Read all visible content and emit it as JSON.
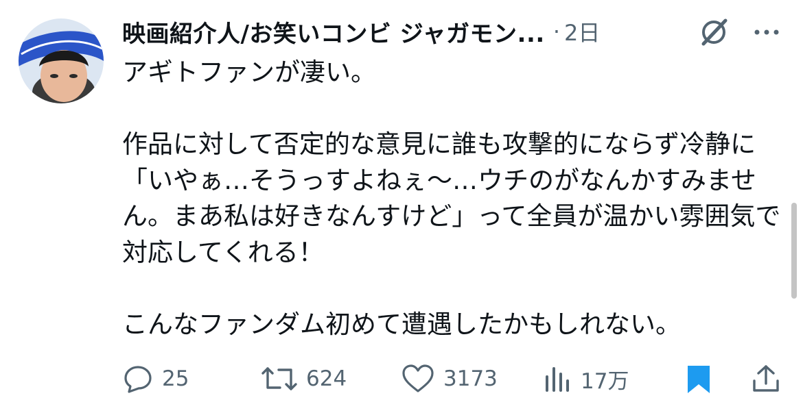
{
  "author": {
    "display_name": "映画紹介人/お笑いコンビ ジャガモン...",
    "time_sep": "·",
    "time": "2日"
  },
  "tweet": {
    "text": "アギトファンが凄い。\n\n作品に対して否定的な意見に誰も攻撃的にならず冷静に「いやぁ…そうっすよねぇ〜…ウチのがなんかすみません。まあ私は好きなんすけど」って全員が温かい雰囲気で対応してくれる！\n\nこんなファンダム初めて遭遇したかもしれない。"
  },
  "actions": {
    "reply": {
      "icon": "reply-icon",
      "count": "25"
    },
    "retweet": {
      "icon": "retweet-icon",
      "count": "624"
    },
    "like": {
      "icon": "heart-icon",
      "count": "3173"
    },
    "views": {
      "icon": "views-icon",
      "count": "17万"
    },
    "bookmark": {
      "icon": "bookmark-icon",
      "active": true
    },
    "share": {
      "icon": "share-icon"
    }
  },
  "colors": {
    "text": "#0f1419",
    "muted": "#536471",
    "bookmark": "#1d9bf0"
  }
}
